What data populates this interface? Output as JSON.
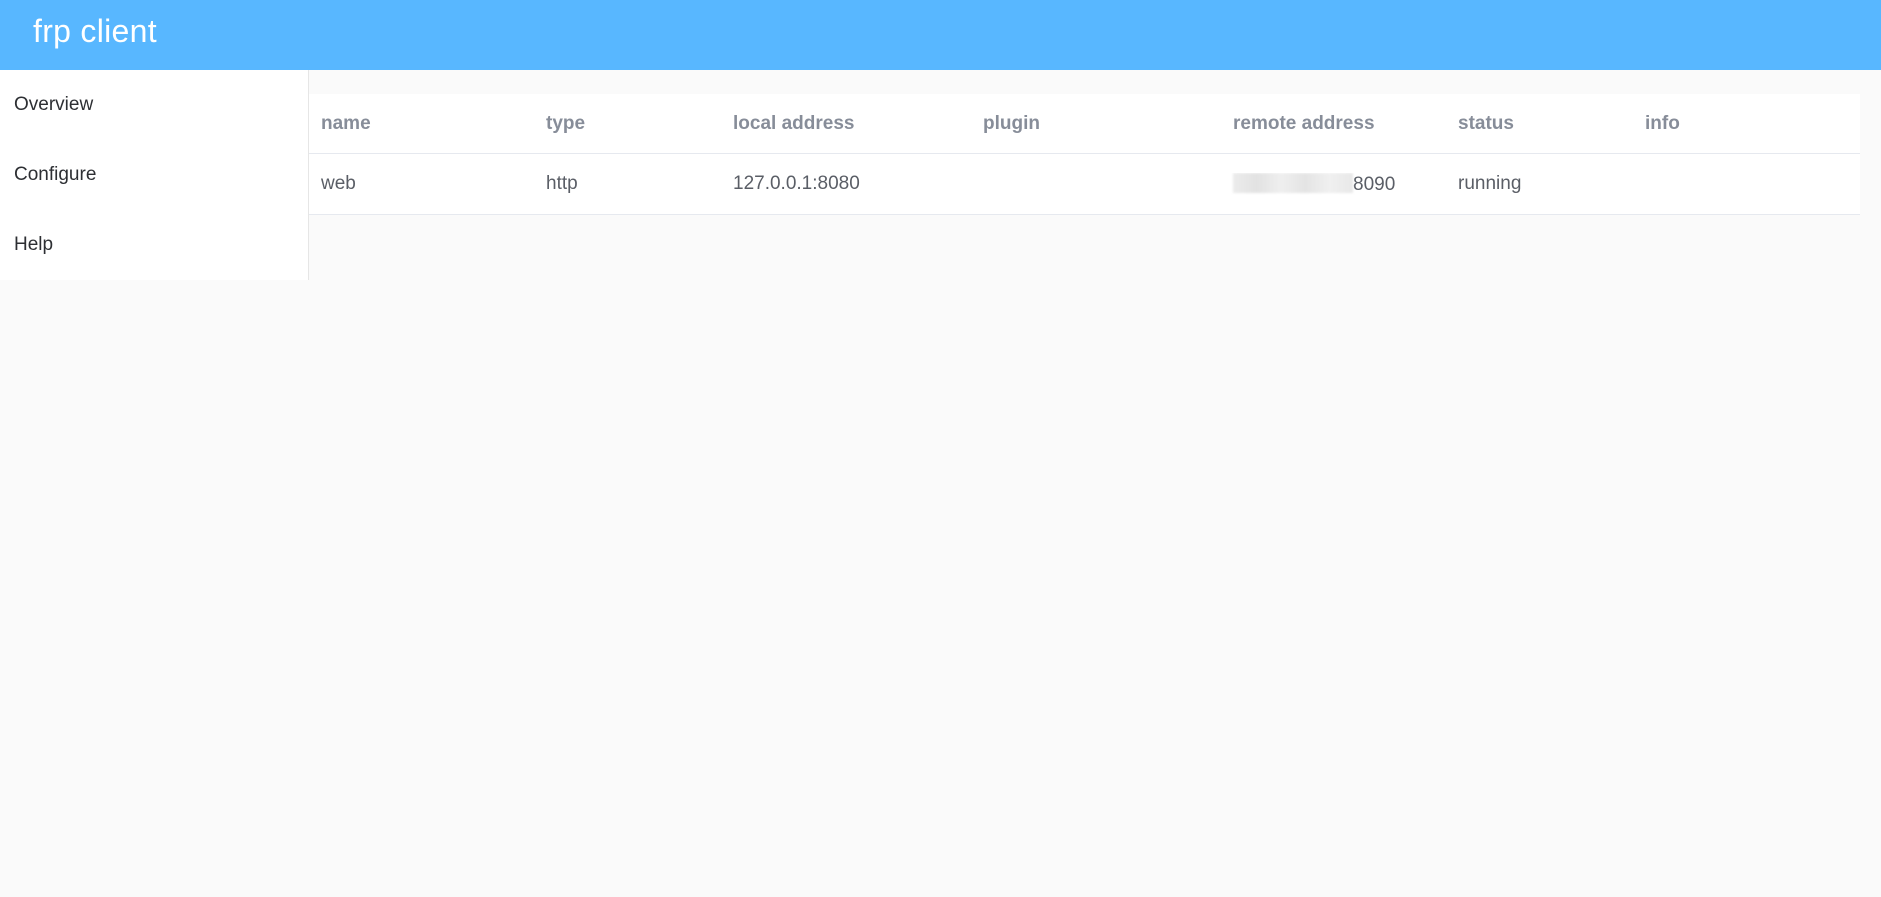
{
  "header": {
    "title": "frp client"
  },
  "sidebar": {
    "items": [
      {
        "label": "Overview"
      },
      {
        "label": "Configure"
      },
      {
        "label": "Help"
      }
    ]
  },
  "table": {
    "columns": [
      "name",
      "type",
      "local address",
      "plugin",
      "remote address",
      "status",
      "info"
    ],
    "rows": [
      {
        "name": "web",
        "type": "http",
        "local_address": "127.0.0.1:8080",
        "plugin": "",
        "remote_address_suffix": "8090",
        "status": "running",
        "info": ""
      }
    ]
  },
  "colors": {
    "header_bg": "#58b7ff",
    "page_bg": "#fafafa"
  }
}
